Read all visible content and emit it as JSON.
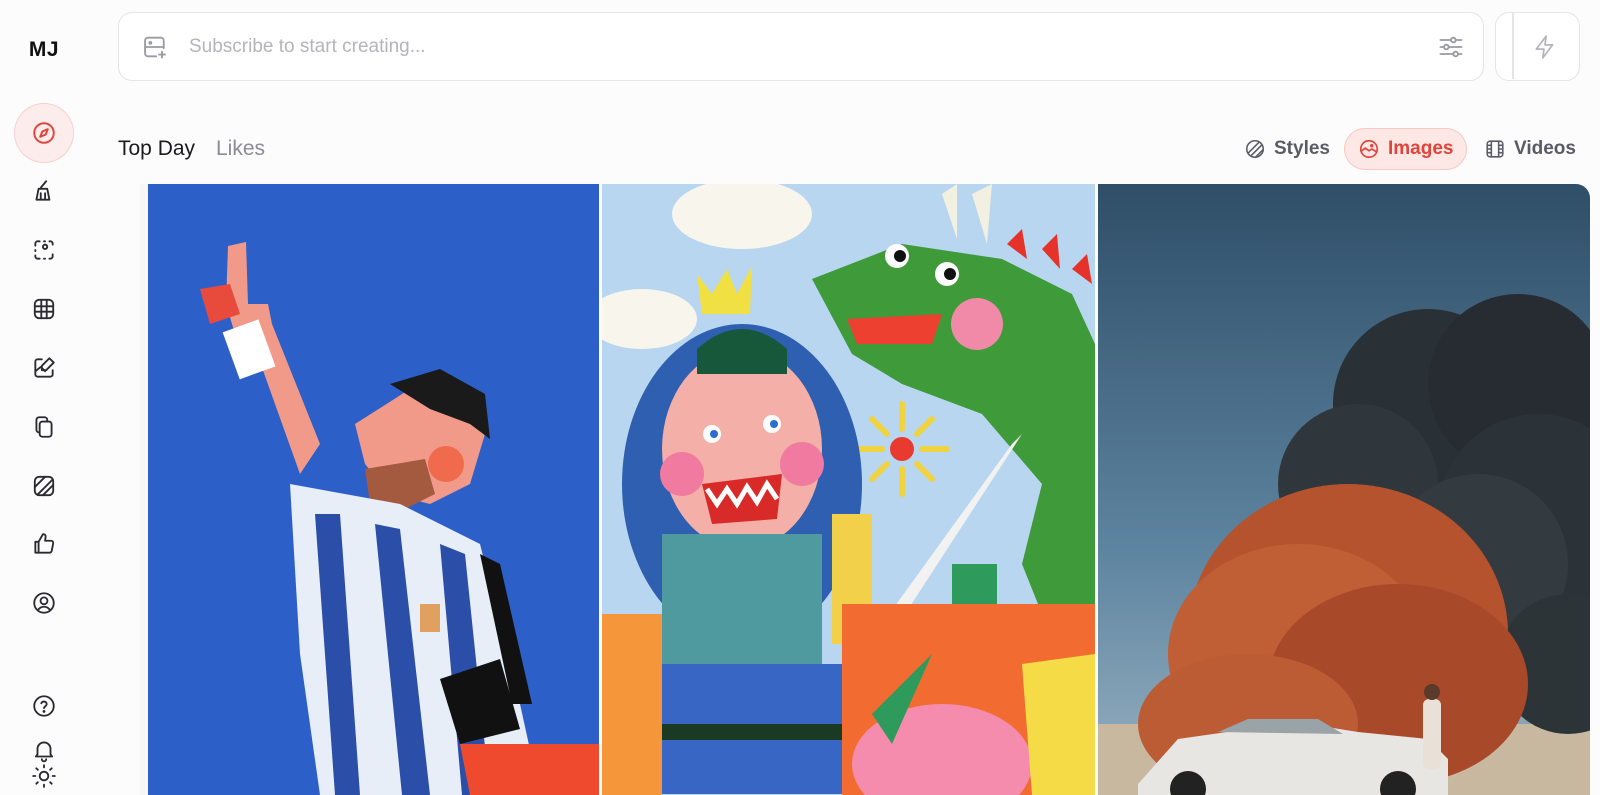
{
  "app": {
    "logo": "MJ"
  },
  "sidebar": {
    "items": [
      {
        "icon": "compass-icon",
        "active": true
      },
      {
        "icon": "brush-icon"
      },
      {
        "icon": "selection-icon"
      },
      {
        "icon": "grid-icon"
      },
      {
        "icon": "edit-image-icon"
      },
      {
        "icon": "copy-icon"
      },
      {
        "icon": "styles-icon"
      },
      {
        "icon": "thumbs-up-icon"
      },
      {
        "icon": "profile-icon"
      },
      {
        "icon": "help-icon"
      },
      {
        "icon": "bell-icon"
      },
      {
        "icon": "sun-icon"
      }
    ]
  },
  "prompt": {
    "placeholder": "Subscribe to start creating..."
  },
  "tabs": [
    {
      "label": "Top Day",
      "active": true
    },
    {
      "label": "Likes"
    }
  ],
  "filters": [
    {
      "label": "Styles",
      "icon": "styles-icon"
    },
    {
      "label": "Images",
      "icon": "image-icon",
      "active": true
    },
    {
      "label": "Videos",
      "icon": "film-icon"
    }
  ],
  "gallery": [
    {
      "name": "football-player-illustration"
    },
    {
      "name": "knight-dragon-painting"
    },
    {
      "name": "car-explosion-photo"
    }
  ],
  "colors": {
    "accent": "#e0443a",
    "accent_bg": "#fde8e6"
  }
}
